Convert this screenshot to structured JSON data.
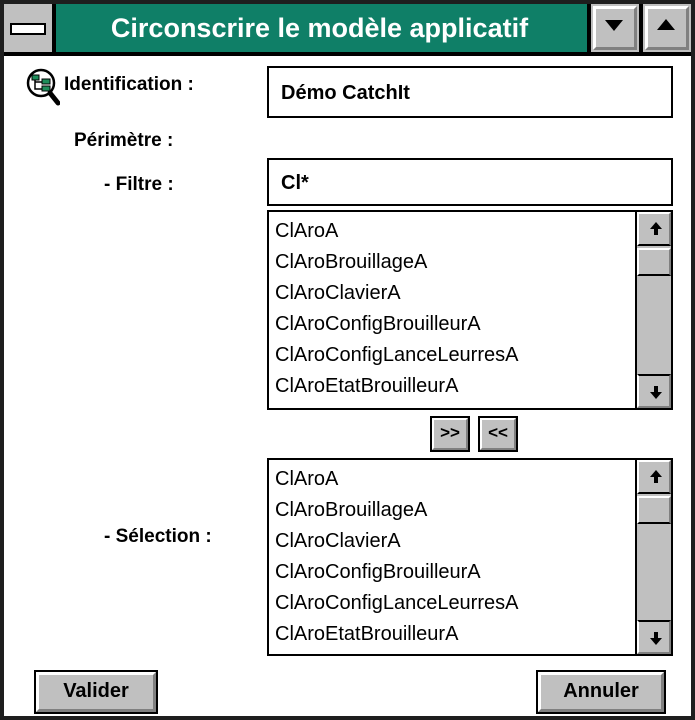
{
  "window": {
    "title": "Circonscrire le modèle applicatif"
  },
  "identification": {
    "label": "Identification :",
    "value": "Démo CatchIt"
  },
  "perimetre": {
    "label": "Périmètre :"
  },
  "filtre": {
    "label": "- Filtre :",
    "value": "Cl*"
  },
  "available_list": {
    "items": [
      "ClAroA",
      "ClAroBrouillageA",
      "ClAroClavierA",
      "ClAroConfigBrouilleurA",
      "ClAroConfigLanceLeurresA",
      "ClAroEtatBrouilleurA"
    ]
  },
  "move_buttons": {
    "add_label": ">>",
    "remove_label": "<<"
  },
  "selection": {
    "label": "- Sélection :",
    "items": [
      "ClAroA",
      "ClAroBrouillageA",
      "ClAroClavierA",
      "ClAroConfigBrouilleurA",
      "ClAroConfigLanceLeurresA",
      "ClAroEtatBrouilleurA"
    ]
  },
  "buttons": {
    "validate_label": "Valider",
    "cancel_label": "Annuler"
  },
  "icons": {
    "identification": "model-tree-magnifier-icon"
  },
  "colors": {
    "title_bar": "#0f7f67",
    "chrome": "#c0c0c0"
  }
}
